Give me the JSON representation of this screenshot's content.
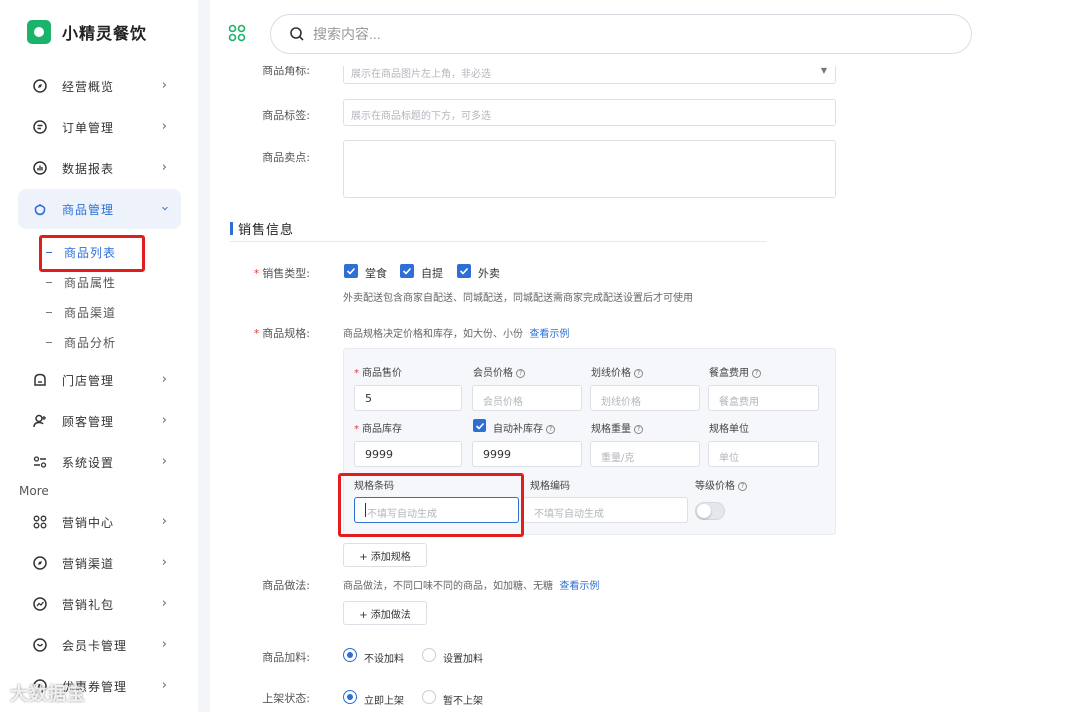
{
  "app": {
    "name": "小精灵餐饮",
    "brand_color": "#1ab36a",
    "accent_color": "#2d6fd6"
  },
  "search": {
    "placeholder": "搜索内容..."
  },
  "sidebar": {
    "items": [
      {
        "label": "经营概览",
        "icon": "dashboard-icon"
      },
      {
        "label": "订单管理",
        "icon": "order-icon"
      },
      {
        "label": "数据报表",
        "icon": "chart-icon"
      },
      {
        "label": "商品管理",
        "icon": "product-icon",
        "active": true
      },
      {
        "label": "门店管理",
        "icon": "store-icon"
      },
      {
        "label": "顾客管理",
        "icon": "customer-icon"
      },
      {
        "label": "系统设置",
        "icon": "settings-icon"
      },
      {
        "label": "营销中心",
        "icon": "marketing-icon"
      },
      {
        "label": "营销渠道",
        "icon": "channel-icon"
      },
      {
        "label": "营销礼包",
        "icon": "gift-icon"
      },
      {
        "label": "会员卡管理",
        "icon": "member-card-icon"
      },
      {
        "label": "优惠券管理",
        "icon": "coupon-icon"
      }
    ],
    "sub_items": [
      "商品列表",
      "商品属性",
      "商品渠道",
      "商品分析"
    ],
    "more_label": "More"
  },
  "form": {
    "partial_label": "商品角标:",
    "partial_placeholder": "展示在商品图片左上角，非必选",
    "tags_label": "商品标签:",
    "tags_placeholder": "展示在商品标题的下方，可多选",
    "selling_label": "商品卖点:",
    "section_title": "销售信息",
    "sale_type_label": "销售类型:",
    "sale_types": [
      "堂食",
      "自提",
      "外卖"
    ],
    "sale_type_hint": "外卖配送包含商家自配送、同城配送，同城配送需商家完成配送设置后才可使用",
    "spec_label": "商品规格:",
    "spec_hint": "商品规格决定价格和库存，如大份、小份",
    "spec_example": "查看示例",
    "spec": {
      "price_label": "商品售价",
      "price_value": "5",
      "member_price_label": "会员价格",
      "member_price_placeholder": "会员价格",
      "strike_price_label": "划线价格",
      "strike_price_placeholder": "划线价格",
      "box_fee_label": "餐盒费用",
      "box_fee_placeholder": "餐盒费用",
      "stock_label": "商品库存",
      "stock_value": "9999",
      "auto_restock_label": "自动补库存",
      "auto_restock_value": "9999",
      "weight_label": "规格重量",
      "weight_placeholder": "重量/克",
      "unit_label": "规格单位",
      "unit_placeholder": "单位",
      "barcode_label": "规格条码",
      "barcode_placeholder": "不填写自动生成",
      "code_label": "规格编码",
      "code_placeholder": "不填写自动生成",
      "level_price_label": "等级价格"
    },
    "add_spec_button": "+ 添加规格",
    "method_label": "商品做法:",
    "method_hint": "商品做法，不同口味不同的商品，如加糖、无糖",
    "method_example": "查看示例",
    "add_method_button": "+ 添加做法",
    "addon_label": "商品加料:",
    "addon_options": [
      "不设加料",
      "设置加料"
    ],
    "shelf_label": "上架状态:",
    "shelf_options": [
      "立即上架",
      "暂不上架"
    ]
  },
  "watermark": "大数据宝"
}
